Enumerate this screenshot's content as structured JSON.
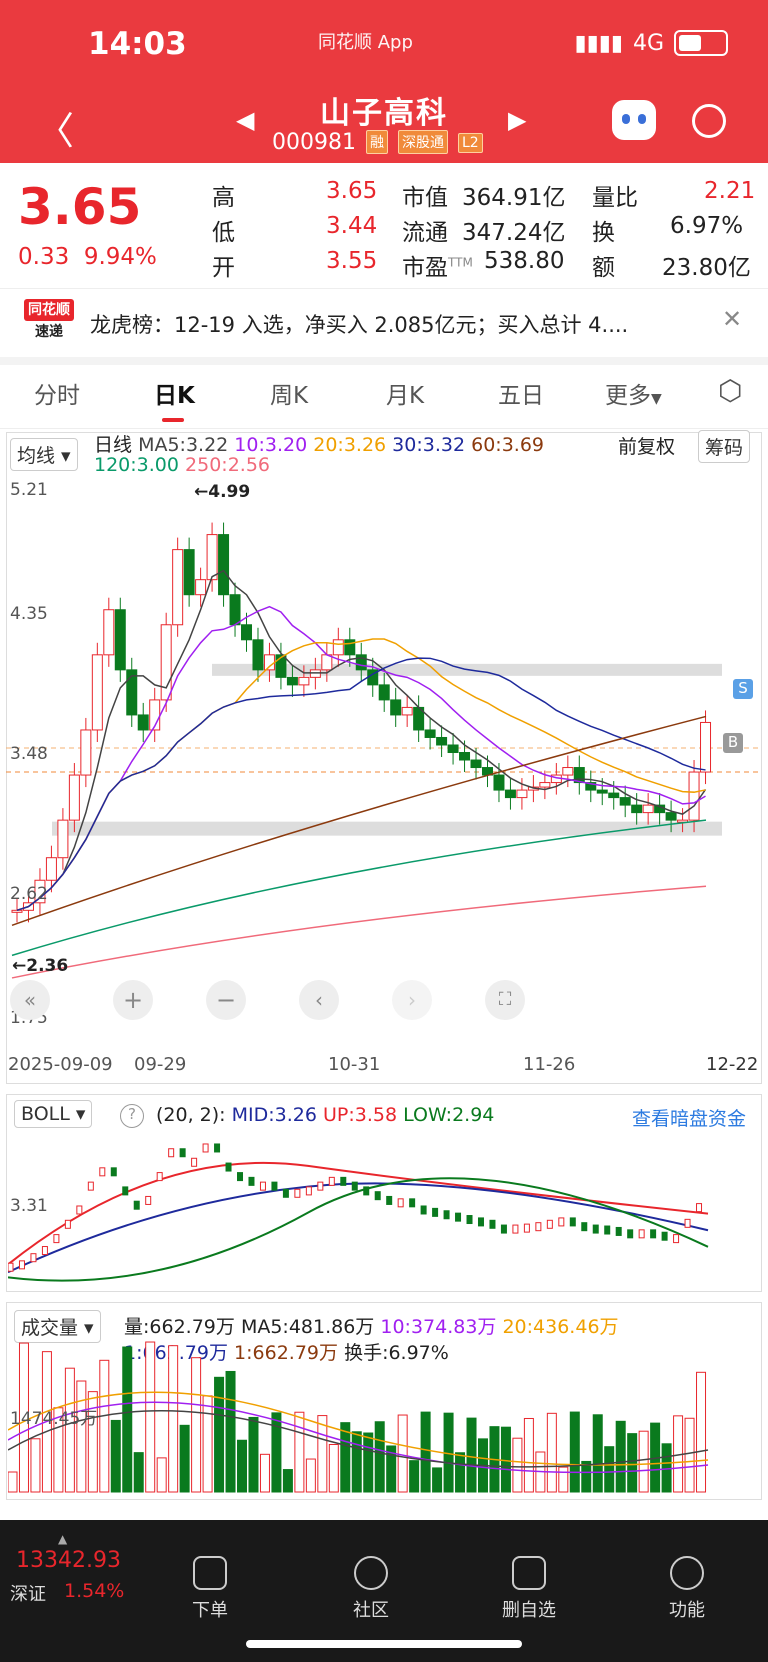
{
  "status": {
    "time": "14:03",
    "app_badge": "同花顺 App",
    "network": "4G"
  },
  "header": {
    "title": "山子高科",
    "code": "000981",
    "tags": [
      "融",
      "深股通",
      "L2"
    ]
  },
  "quote": {
    "price": "3.65",
    "change": "0.33",
    "change_pct": "9.94%",
    "rows": [
      {
        "l1": "高",
        "v1": "3.65",
        "l2": "市值",
        "v2": "364.91亿",
        "l3": "量比",
        "v3": "2.21"
      },
      {
        "l1": "低",
        "v1": "3.44",
        "l2": "流通",
        "v2": "347.24亿",
        "l3": "换",
        "v3": "6.97%"
      },
      {
        "l1": "开",
        "v1": "3.55",
        "l2": "市盈",
        "v2": "538.80",
        "l2sup": "TTM",
        "l3": "额",
        "v3": "23.80亿"
      }
    ]
  },
  "news": {
    "badge_top": "同花顺",
    "badge_bottom": "速递",
    "text": "龙虎榜：12-19 入选，净买入 2.085亿元；买入总计 4...."
  },
  "tabs": [
    "分时",
    "日K",
    "周K",
    "月K",
    "五日",
    "更多"
  ],
  "kline": {
    "indicator_btn": "均线",
    "line_label": "日线",
    "ma": [
      {
        "label": "MA5:3.22",
        "color": "#444444"
      },
      {
        "label": "10:3.20",
        "color": "#a020f0"
      },
      {
        "label": "20:3.26",
        "color": "#f0a000"
      },
      {
        "label": "30:3.32",
        "color": "#1e2a9c"
      },
      {
        "label": "60:3.69",
        "color": "#8b3a0e"
      },
      {
        "label": "120:3.00",
        "color": "#0a9a6a"
      },
      {
        "label": "250:2.56",
        "color": "#f06a7a"
      }
    ],
    "adj_label": "前复权",
    "chip_btn": "筹码",
    "y_ticks": [
      "5.21",
      "4.35",
      "3.48",
      "2.62",
      "1.75"
    ],
    "high_mark": "←4.99",
    "low_mark": "←2.36",
    "x_ticks": [
      "2025-09-09",
      "09-29",
      "10-31",
      "11-26",
      "12-22"
    ],
    "markers": {
      "s": "S",
      "b": "B"
    }
  },
  "boll": {
    "btn": "BOLL",
    "params": "(20, 2):",
    "mid": "MID:3.26",
    "up": "UP:3.58",
    "low": "LOW:2.94",
    "link": "查看暗盘资金",
    "y_tick": "3.31"
  },
  "volume": {
    "btn": "成交量",
    "vol": "量:662.79万",
    "ma5": "MA5:481.86万",
    "ma10": "10:374.83万",
    "ma20": "20:436.46万",
    "l2a": "1:662.79万",
    "l2b": "1:662.79万",
    "turnover": "换手:6.97%",
    "y_tick": "1474.45万"
  },
  "bottom": {
    "index_value": "13342.93",
    "index_name": "深证",
    "index_pct": "1.54%",
    "nav": [
      "下单",
      "社区",
      "删自选",
      "功能"
    ]
  },
  "colors": {
    "up": "#e8262c",
    "down": "#0a7a1e",
    "header": "#ea3a3f"
  }
}
